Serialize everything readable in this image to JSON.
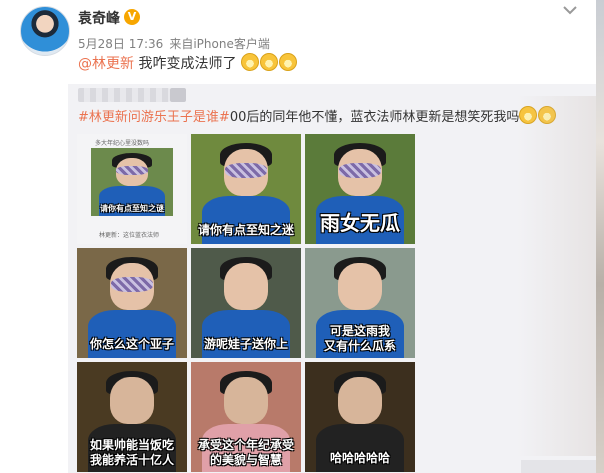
{
  "post": {
    "author": "袁奇峰",
    "verified_badge": "V",
    "date": "5月28日 17:36",
    "source_prefix": "来自",
    "source": "iPhone客户端",
    "mention": "@林更新",
    "text": " 我咋变成法师了"
  },
  "repost": {
    "mention": "#林更新",
    "hashtag": "问游乐王子是谁#",
    "text": "00后的同年他不懂，蓝衣法师林更新是想笑死我吗"
  },
  "tiles": [
    {
      "caption": "请你有点至知之谜",
      "top_note": "多大年纪心里没数吗",
      "bottom_note": "林更新：这位蓝衣法师"
    },
    {
      "caption": "请你有点至知之迷"
    },
    {
      "caption": "雨女无瓜"
    },
    {
      "caption": "你怎么这个亚子"
    },
    {
      "caption": "游呢娃子送你上"
    },
    {
      "caption_line1": "可是这雨我",
      "caption_line2": "又有什么瓜系"
    },
    {
      "caption_line1": "如果帅能当饭吃",
      "caption_line2": "我能养活十亿人"
    },
    {
      "caption_line1": "承受这个年纪承受",
      "caption_line2": "的美貌与智慧"
    },
    {
      "caption": "哈哈哈哈哈"
    }
  ],
  "icons": {
    "menu": "chevron-down-icon",
    "emoji": "laugh-cry-emoji"
  },
  "colors": {
    "accent": "#eb7350",
    "verified": "#f7a600"
  }
}
